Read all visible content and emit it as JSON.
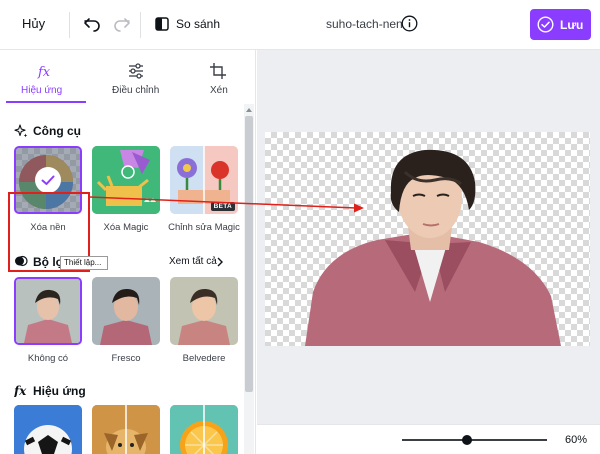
{
  "topbar": {
    "cancel_label": "Hủy",
    "compare_label": "So sánh",
    "filename": "suho-tach-nen",
    "save_label": "Lưu"
  },
  "tabs": [
    {
      "label": "Hiệu ứng",
      "icon": "fx-icon",
      "active": true
    },
    {
      "label": "Điều chỉnh",
      "icon": "sliders-icon",
      "active": false
    },
    {
      "label": "Xén",
      "icon": "crop-icon",
      "active": false
    }
  ],
  "tools": {
    "title": "Công cụ",
    "items": [
      {
        "label": "Xóa nền",
        "selected": true
      },
      {
        "label": "Xóa Magic"
      },
      {
        "label": "Chỉnh sửa Magic",
        "badge": "BETA"
      }
    ],
    "tooltip": "Thiết lập..."
  },
  "filters": {
    "title": "Bộ lọc",
    "see_all": "Xem tất cả",
    "items": [
      {
        "label": "Không có"
      },
      {
        "label": "Fresco"
      },
      {
        "label": "Belvedere"
      }
    ]
  },
  "effects": {
    "title": "Hiệu ứng"
  },
  "zoom": {
    "label": "60%",
    "value_percent": 60
  },
  "colors": {
    "accent": "#8b3dff",
    "annotation_red": "#e0201a"
  }
}
